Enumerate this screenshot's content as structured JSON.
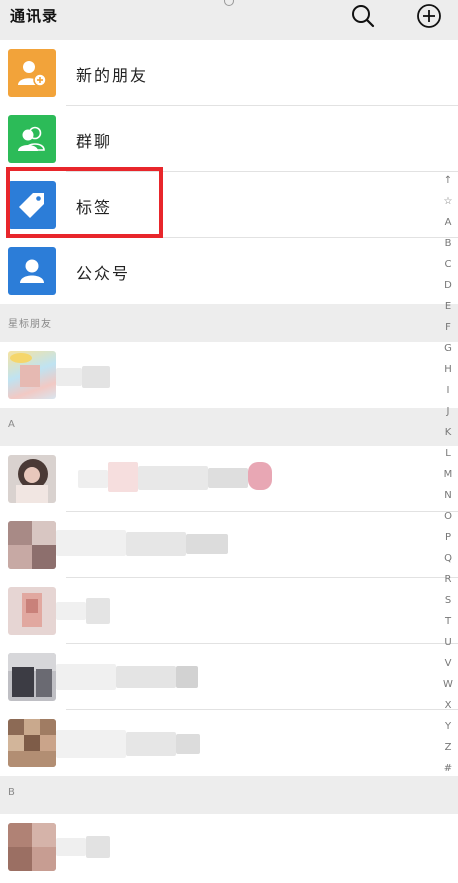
{
  "header": {
    "title": "通讯录",
    "search_icon": "search-icon",
    "add_icon": "add-circle-icon"
  },
  "features": [
    {
      "label": "新的朋友",
      "color": "#f2a33a",
      "icon": "add-friend-icon"
    },
    {
      "label": "群聊",
      "color": "#2cbb58",
      "icon": "group-chat-icon"
    },
    {
      "label": "标签",
      "color": "#2c7dd8",
      "icon": "tag-icon"
    },
    {
      "label": "公众号",
      "color": "#2c7dd8",
      "icon": "official-account-icon"
    }
  ],
  "annotation": {
    "color": "#e8262b"
  },
  "sections": {
    "starred": "星标朋友",
    "a": "A",
    "b": "B"
  },
  "index_letters": [
    "↑",
    "☆",
    "A",
    "B",
    "C",
    "D",
    "E",
    "F",
    "G",
    "H",
    "I",
    "J",
    "K",
    "L",
    "M",
    "N",
    "O",
    "P",
    "Q",
    "R",
    "S",
    "T",
    "U",
    "V",
    "W",
    "X",
    "Y",
    "Z",
    "#"
  ]
}
